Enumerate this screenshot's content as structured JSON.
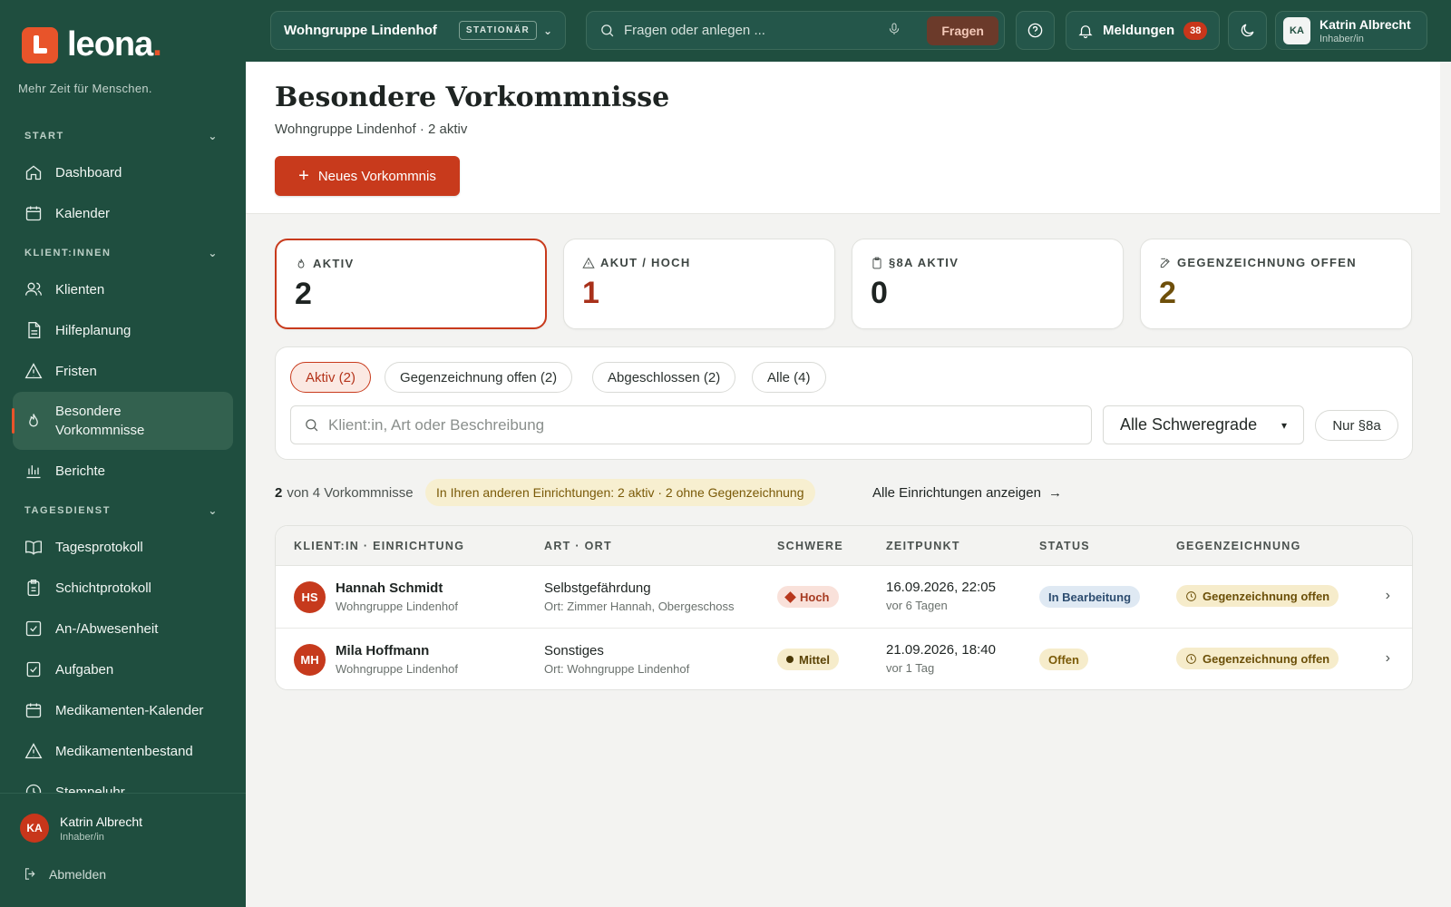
{
  "sidebar": {
    "logo_text": "leona",
    "logo_dot": ".",
    "tagline": "Mehr Zeit für Menschen.",
    "sections": [
      {
        "title": "START",
        "items": [
          {
            "label": "Dashboard",
            "icon": "home-icon"
          },
          {
            "label": "Kalender",
            "icon": "calendar-icon"
          }
        ]
      },
      {
        "title": "KLIENT:INNEN",
        "items": [
          {
            "label": "Klienten",
            "icon": "users-icon"
          },
          {
            "label": "Hilfeplanung",
            "icon": "document-icon"
          },
          {
            "label": "Fristen",
            "icon": "warning-icon"
          },
          {
            "label": "Besondere Vorkommnisse",
            "icon": "flame-icon",
            "active": true
          },
          {
            "label": "Berichte",
            "icon": "bar-chart-icon"
          }
        ]
      },
      {
        "title": "TAGESDIENST",
        "items": [
          {
            "label": "Tagesprotokoll",
            "icon": "book-icon"
          },
          {
            "label": "Schichtprotokoll",
            "icon": "clipboard-icon"
          },
          {
            "label": "An-/Abwesenheit",
            "icon": "checkbox-icon"
          },
          {
            "label": "Aufgaben",
            "icon": "task-icon"
          },
          {
            "label": "Medikamenten-Kalender",
            "icon": "calendar-icon"
          },
          {
            "label": "Medikamentenbestand",
            "icon": "warning-icon"
          },
          {
            "label": "Stempeluhr",
            "icon": "clock-icon"
          }
        ]
      }
    ],
    "footer": {
      "initials": "KA",
      "name": "Katrin Albrecht",
      "role": "Inhaber/in",
      "logout": "Abmelden"
    }
  },
  "topbar": {
    "location": "Wohngruppe Lindenhof",
    "location_badge": "STATIONÄR",
    "search_placeholder": "Fragen oder anlegen ...",
    "ask_button": "Fragen",
    "notifications_label": "Meldungen",
    "notifications_count": "38",
    "user_initials": "KA",
    "user_name": "Katrin Albrecht",
    "user_role": "Inhaber/in"
  },
  "page": {
    "title": "Besondere Vorkommnisse",
    "subtitle": "Wohngruppe Lindenhof · 2 aktiv",
    "new_button": "Neues Vorkommnis"
  },
  "stats": [
    {
      "label": "AKTIV",
      "value": "2",
      "icon": "flame-icon",
      "color": "#1e2422"
    },
    {
      "label": "AKUT / HOCH",
      "value": "1",
      "icon": "warning-icon",
      "color": "#a8301a"
    },
    {
      "label": "§8A AKTIV",
      "value": "0",
      "icon": "clipboard-icon",
      "color": "#1e2422"
    },
    {
      "label": "GEGENZEICHNUNG OFFEN",
      "value": "2",
      "icon": "edit-icon",
      "color": "#6e4f0a"
    }
  ],
  "filters": {
    "chips": [
      "Aktiv (2)",
      "Gegenzeichnung offen (2)",
      "Abgeschlossen (2)",
      "Alle (4)"
    ],
    "search_placeholder": "Klient:in, Art oder Beschreibung",
    "severity_select": "Alle Schweregrade",
    "only_8a": "Nur §8a"
  },
  "summary": {
    "count_bold": "2",
    "count_rest": "von 4 Vorkommnisse",
    "info": "In Ihren anderen Einrichtungen: 2 aktiv · 2 ohne Gegenzeichnung",
    "all_link": "Alle Einrichtungen anzeigen"
  },
  "table": {
    "headers": [
      "KLIENT:IN · EINRICHTUNG",
      "ART · ORT",
      "SCHWERE",
      "ZEITPUNKT",
      "STATUS",
      "GEGENZEICHNUNG"
    ],
    "rows": [
      {
        "initials": "HS",
        "name": "Hannah Schmidt",
        "facility": "Wohngruppe Lindenhof",
        "type": "Selbstgefährdung",
        "place": "Ort: Zimmer Hannah, Obergeschoss",
        "severity": "Hoch",
        "time": "16.09.2026, 22:05",
        "ago": "vor 6 Tagen",
        "status": "In Bearbeitung",
        "countersign": "Gegenzeichnung offen"
      },
      {
        "initials": "MH",
        "name": "Mila Hoffmann",
        "facility": "Wohngruppe Lindenhof",
        "type": "Sonstiges",
        "place": "Ort: Wohngruppe Lindenhof",
        "severity": "Mittel",
        "time": "21.09.2026, 18:40",
        "ago": "vor 1 Tag",
        "status": "Offen",
        "countersign": "Gegenzeichnung offen"
      }
    ]
  }
}
